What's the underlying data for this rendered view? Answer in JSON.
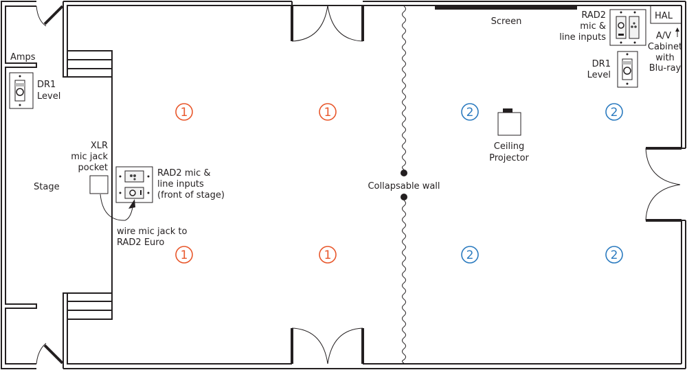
{
  "labels": {
    "amps": "Amps",
    "dr1_left": [
      "DR1",
      "Level"
    ],
    "stage": "Stage",
    "xlr_pocket": [
      "XLR",
      "mic jack",
      "pocket"
    ],
    "rad2_front": [
      "RAD2 mic &",
      "line inputs",
      "(front of stage)"
    ],
    "wire_note": [
      "wire mic jack to",
      "RAD2 Euro"
    ],
    "collapsable_wall": "Collapsable wall",
    "screen": "Screen",
    "ceiling_projector": [
      "Ceiling",
      "Projector"
    ],
    "rad2_right": [
      "RAD2",
      "mic &",
      "line inputs"
    ],
    "dr1_right": [
      "DR1",
      "Level"
    ],
    "hal": "HAL",
    "av_cabinet": [
      "A/V",
      "Cabinet",
      "with",
      "Blu-ray"
    ]
  },
  "zones": {
    "zone1_label": "1",
    "zone2_label": "2",
    "zone1_color": "#e8562a",
    "zone2_color": "#2a7abf"
  }
}
